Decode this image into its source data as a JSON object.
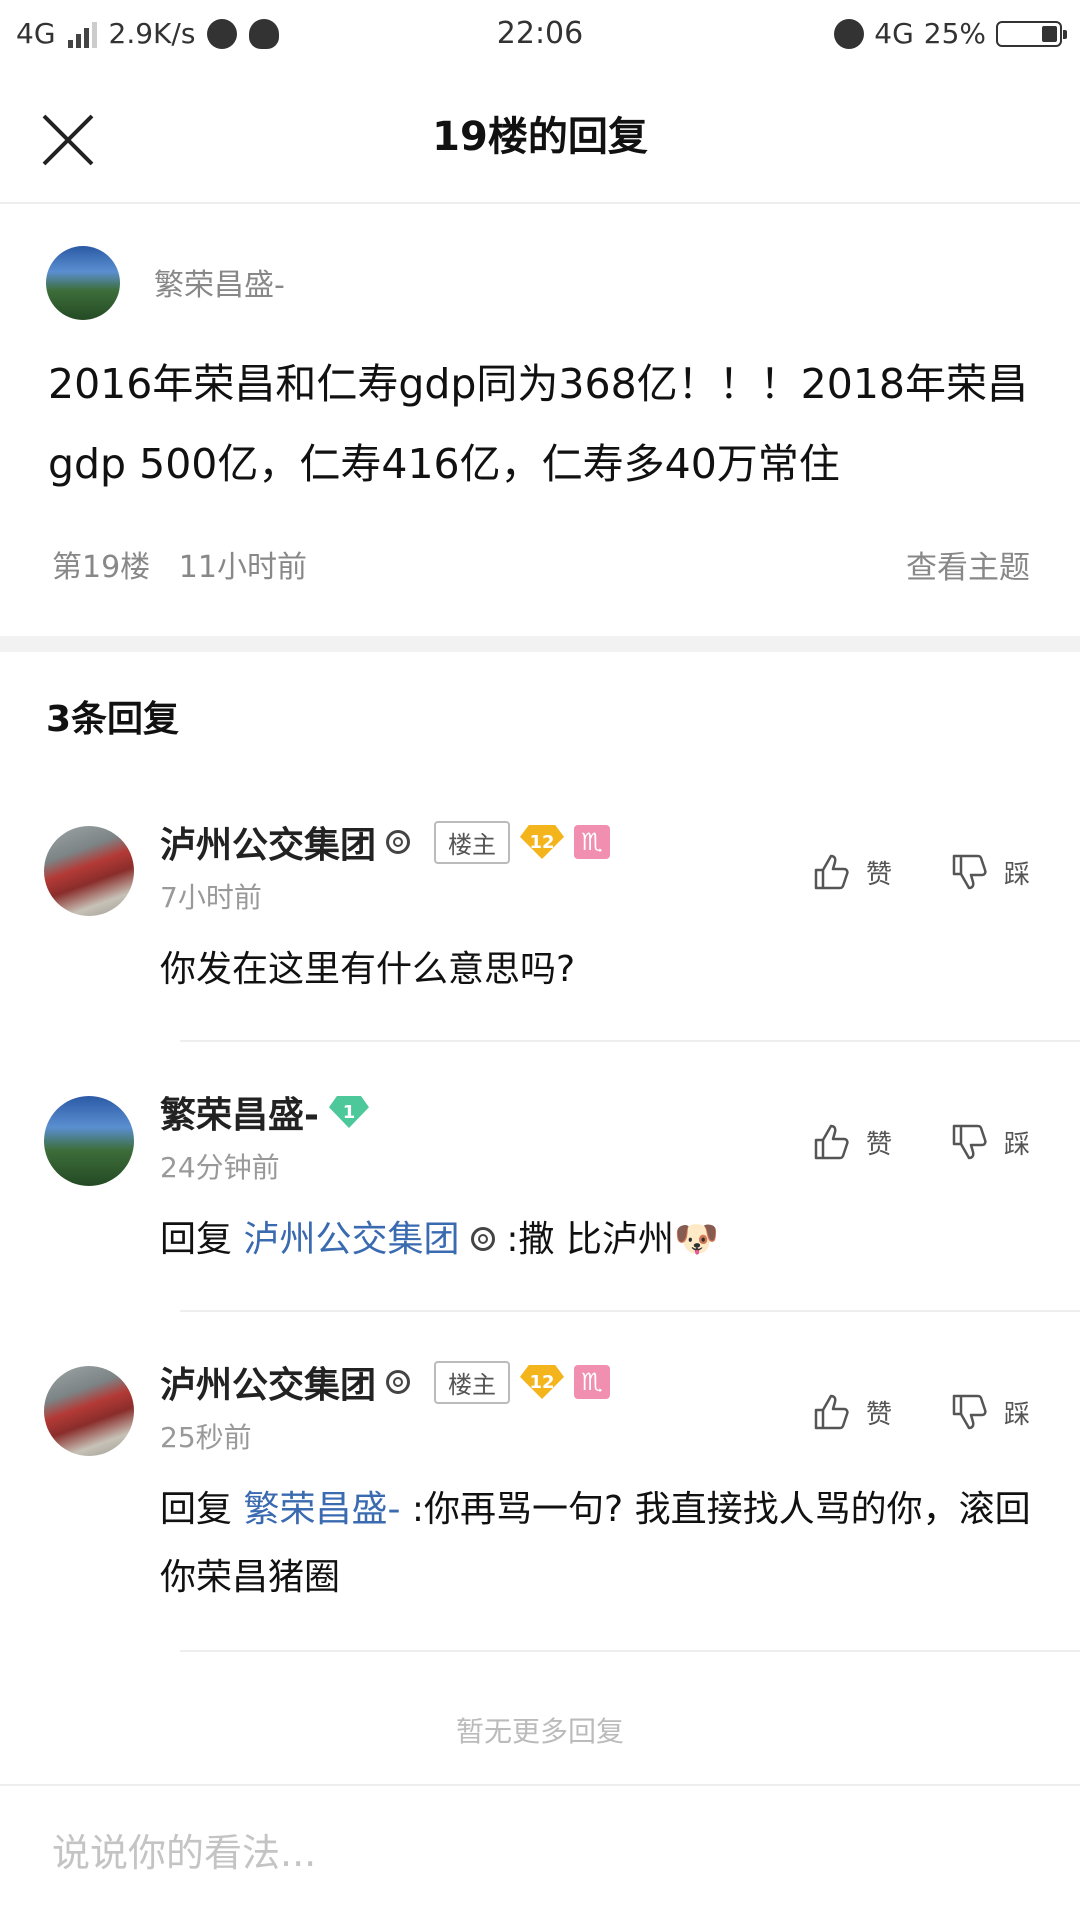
{
  "status_bar": {
    "network": "4G",
    "speed": "2.9K/s",
    "time": "22:06",
    "network_right": "4G",
    "battery": "25%",
    "battery_level": 0.25
  },
  "header": {
    "title": "19楼的回复",
    "close_icon": "close-icon"
  },
  "main_post": {
    "author": "繁荣昌盛-",
    "content": "2016年荣昌和仁寿gdp同为368亿！！！2018年荣昌gdp 500亿，仁寿416亿，仁寿多40万常住",
    "floor": "第19楼",
    "time": "11小时前",
    "view_topic": "查看主题"
  },
  "replies_header": "3条回复",
  "vote_labels": {
    "like": "赞",
    "dislike": "踩"
  },
  "replies": [
    {
      "name": "泸州公交集团",
      "tag": "楼主",
      "level": "12",
      "zodiac": "♏",
      "time": "7小时前",
      "prefix": "",
      "mention": "",
      "text": "你发在这里有什么意思吗?"
    },
    {
      "name": "繁荣昌盛-",
      "level": "1",
      "time": "24分钟前",
      "prefix": "回复",
      "mention": "泸州公交集团",
      "text": ":撒 比泸州🐶"
    },
    {
      "name": "泸州公交集团",
      "tag": "楼主",
      "level": "12",
      "zodiac": "♏",
      "time": "25秒前",
      "prefix": "回复",
      "mention": "繁荣昌盛-",
      "text": ":你再骂一句? 我直接找人骂的你，滚回你荣昌猪圈"
    }
  ],
  "no_more": "暂无更多回复",
  "input": {
    "placeholder": "说说你的看法..."
  },
  "colors": {
    "link": "#3a6ab0",
    "gold_badge": "#f3b41c",
    "green_badge": "#4cc89a",
    "zodiac_badge": "#f18fb0"
  }
}
